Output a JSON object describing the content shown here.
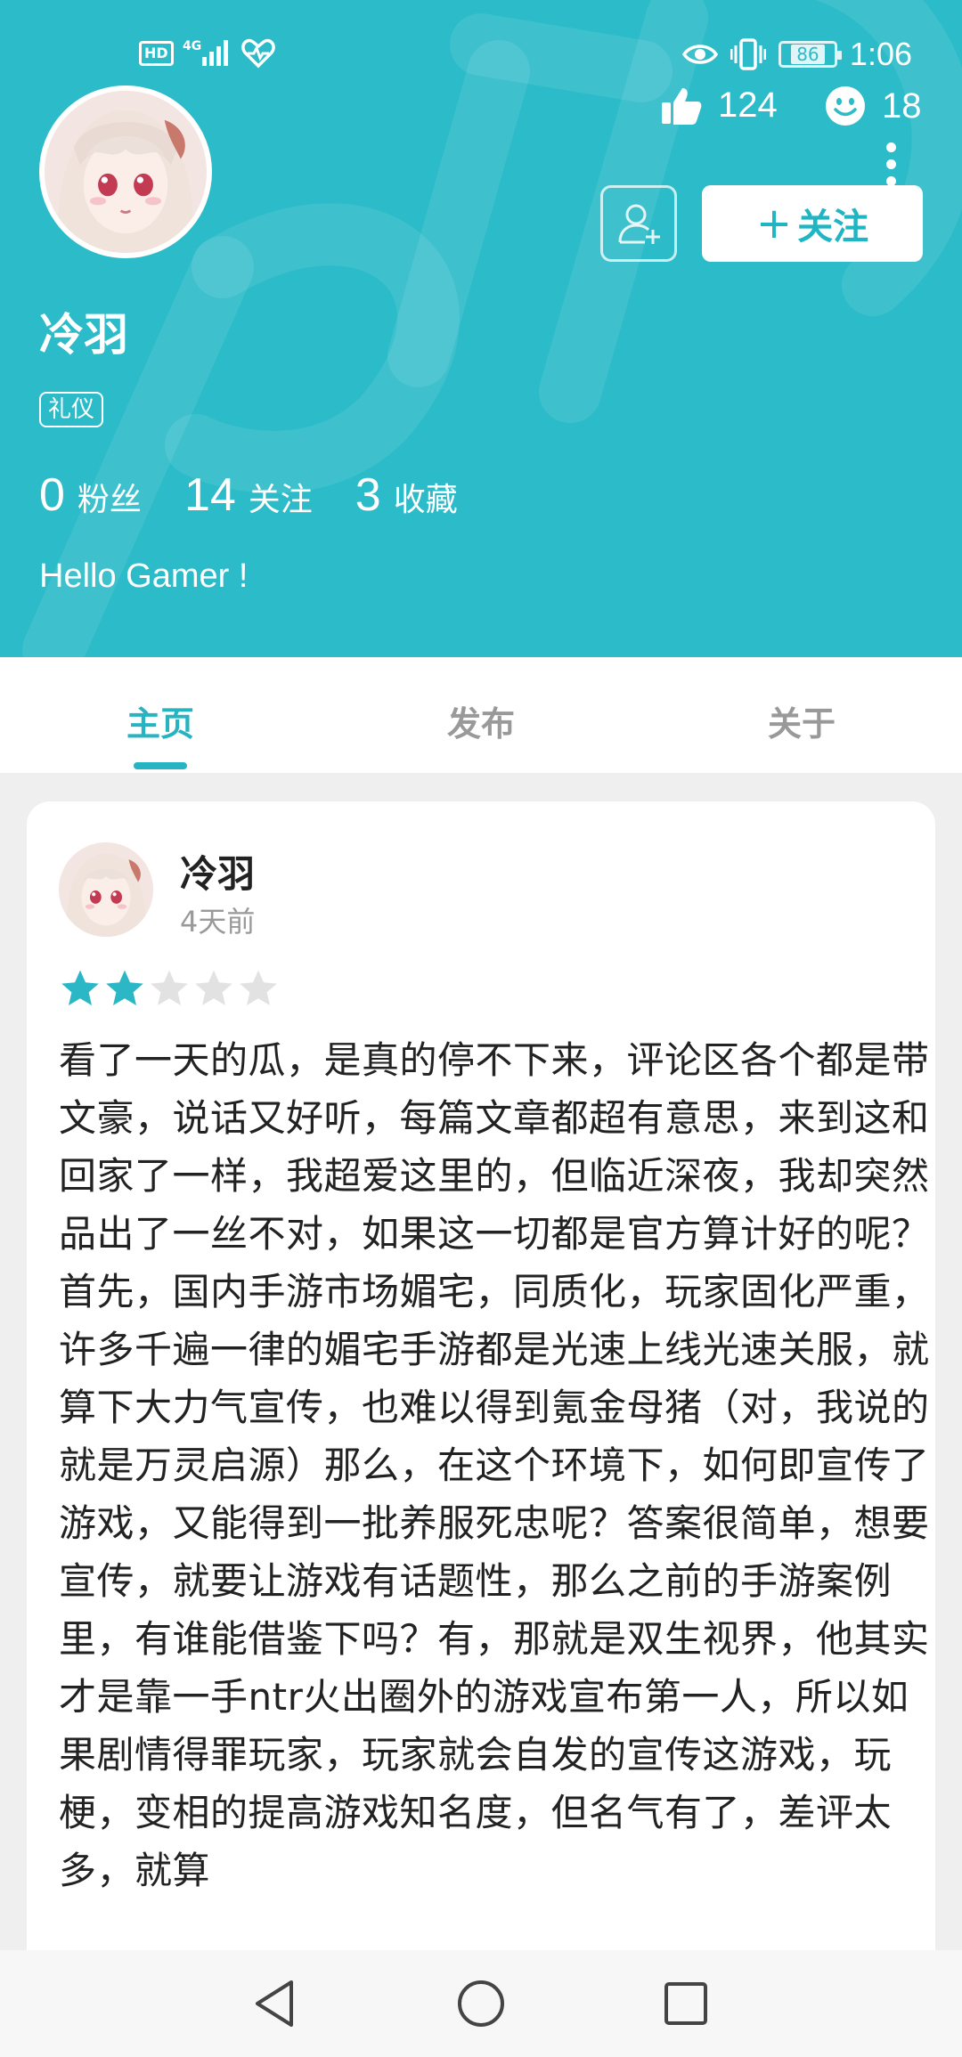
{
  "status_bar": {
    "hd": "HD",
    "network": "4G",
    "battery": "86",
    "time": "1:06"
  },
  "profile": {
    "likes": "124",
    "smiles": "18",
    "follow_label": "关注",
    "name": "冷羽",
    "tag": "礼仪",
    "stats": {
      "fans_num": "0",
      "fans_label": "粉丝",
      "following_num": "14",
      "following_label": "关注",
      "favorites_num": "3",
      "favorites_label": "收藏"
    },
    "bio": "Hello Gamer !"
  },
  "tabs": [
    {
      "label": "主页",
      "active": true
    },
    {
      "label": "发布",
      "active": false
    },
    {
      "label": "关于",
      "active": false
    }
  ],
  "post": {
    "author": "冷羽",
    "time": "4天前",
    "rating": 2,
    "rating_max": 5,
    "paragraphs": [
      "看了一天的瓜，是真的停不下来，评论区各个都是带文豪，说话又好听，每篇文章都超有意思，来到这和回家了一样，我超爱这里的，但临近深夜，我却突然品出了一丝不对，如果这一切都是官方算计好的呢？",
      "首先，国内手游市场媚宅，同质化，玩家固化严重，许多千遍一律的媚宅手游都是光速上线光速关服，就算下大力气宣传，也难以得到氪金母猪（对，我说的就是万灵启源）那么，在这个环境下，如何即宣传了游戏，又能得到一批养服死忠呢？答案很简单，想要宣传，就要让游戏有话题性，那么之前的手游案例里，有谁能借鉴下吗？有，那就是双生视界，他其实才是靠一手ntr火出圈外的游戏宣布第一人，所以如果剧情得罪玩家，玩家就会自发的宣传这游戏，玩梗，变相的提高游戏知名度，但名气有了，差评太多，就算"
    ]
  },
  "colors": {
    "header_bg": "#2bbbc9",
    "accent": "#26b3c2",
    "star_on": "#2bb7c5",
    "star_off": "#e2e2e2"
  },
  "icons": {
    "status_left": [
      "hd-icon",
      "signal-icon",
      "health-icon"
    ],
    "status_right": [
      "eye-icon",
      "vibrate-icon",
      "battery-icon"
    ],
    "header": [
      "thumbs-up-icon",
      "smile-icon",
      "more-vertical-icon",
      "add-friend-icon",
      "plus-icon"
    ],
    "nav": [
      "back-icon",
      "home-icon",
      "recents-icon"
    ]
  }
}
